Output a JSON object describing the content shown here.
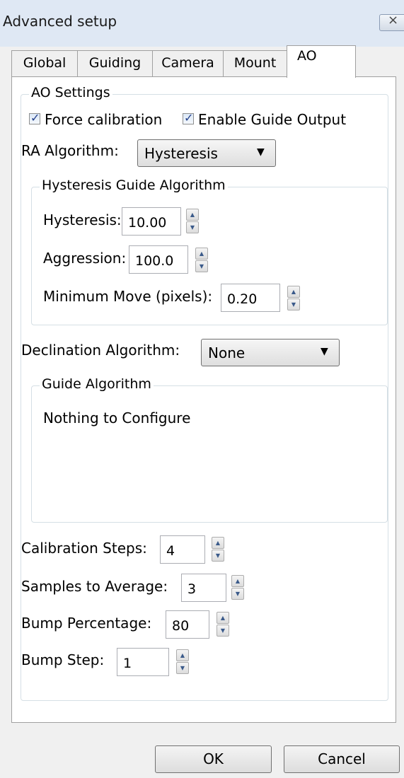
{
  "window": {
    "title": "Advanced setup",
    "close_icon": "×"
  },
  "tabs": [
    "Global",
    "Guiding",
    "Camera",
    "Mount",
    "AO"
  ],
  "ao_settings": {
    "group_label": "AO Settings",
    "force_calibration": {
      "label": "Force calibration",
      "checked": true
    },
    "enable_guide_output": {
      "label": "Enable Guide Output",
      "checked": true
    },
    "ra_algorithm_label": "RA Algorithm:",
    "ra_algorithm_value": "Hysteresis",
    "hysteresis_group": {
      "label": "Hysteresis Guide Algorithm",
      "hysteresis_label": "Hysteresis:",
      "hysteresis_value": "10.00",
      "aggression_label": "Aggression:",
      "aggression_value": "100.0",
      "min_move_label": "Minimum Move (pixels):",
      "min_move_value": "0.20"
    },
    "dec_algorithm_label": "Declination Algorithm:",
    "dec_algorithm_value": "None",
    "guide_group": {
      "label": "Guide Algorithm",
      "message": "Nothing to Configure"
    },
    "calibration_steps_label": "Calibration Steps:",
    "calibration_steps_value": "4",
    "samples_label": "Samples to Average:",
    "samples_value": "3",
    "bump_percentage_label": "Bump Percentage:",
    "bump_percentage_value": "80",
    "bump_step_label": "Bump Step:",
    "bump_step_value": "1"
  },
  "buttons": {
    "ok": "OK",
    "cancel": "Cancel"
  }
}
